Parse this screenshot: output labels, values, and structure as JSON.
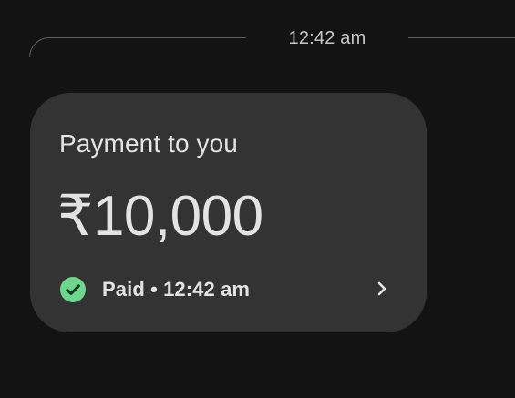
{
  "divider": {
    "time": "12:42 am"
  },
  "payment_card": {
    "title": "Payment to you",
    "amount": "₹10,000",
    "status": "Paid • 12:42 am",
    "status_icon": "check-circle-icon",
    "action_icon": "chevron-right-icon"
  },
  "colors": {
    "background": "#131313",
    "card": "#333333",
    "text": "#e3e3e3",
    "success": "#6dd58c"
  }
}
